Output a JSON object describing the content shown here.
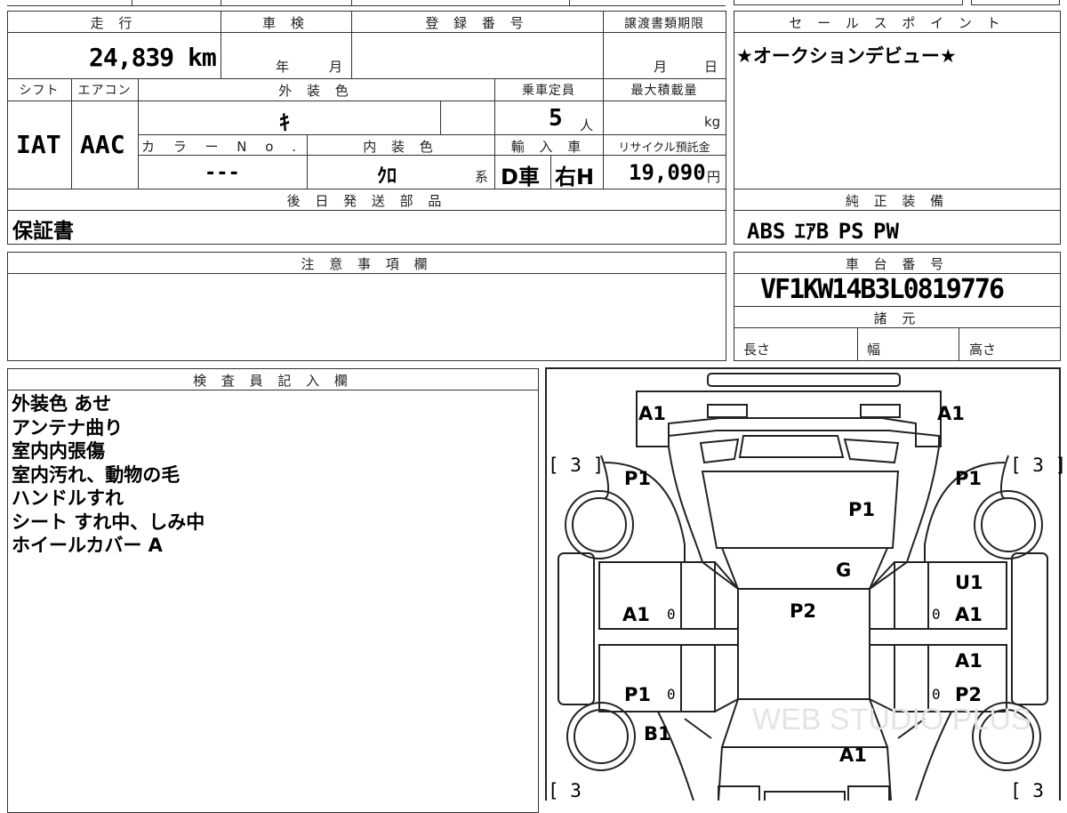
{
  "headers": {
    "mileage": "走 行",
    "inspection": "車 検",
    "registration": "登 録 番 号",
    "transfer_deadline": "譲渡書類期限",
    "sales_point": "セ ー ル ス ポ イ ン ト",
    "shift": "シフト",
    "aircon": "エアコン",
    "exterior_color": "外 装 色",
    "capacity": "乗車定員",
    "max_load": "最大積載量",
    "color_no": "カ ラ ー N o .",
    "interior_color": "内 装 色",
    "import": "輸 入 車",
    "recycle": "リサイクル預託金",
    "later_parts": "後 日 発 送 部 品",
    "equipment": "純 正 装 備",
    "notes": "注 意 事 項 欄",
    "chassis": "車 台 番 号",
    "specs": "諸 元",
    "inspector": "検 査 員 記 入 欄"
  },
  "vehicle": {
    "mileage": "24,839 km",
    "inspection_year_unit": "年",
    "inspection_month_unit": "月",
    "deadline_month_unit": "月",
    "deadline_day_unit": "日",
    "shift": "IAT",
    "aircon": "AAC",
    "exterior_color": "ｷ",
    "capacity": "5",
    "capacity_unit": "人",
    "max_load_unit": "kg",
    "color_no": "---",
    "interior_color": "ｸﾛ",
    "interior_suffix": "系",
    "import_type": "D車",
    "steering": "右H",
    "recycle_fee": "19,090",
    "recycle_unit": "円",
    "later_parts": "保証書",
    "equipment": "ABS ｴｱB PS PW",
    "chassis_number": "VF1KW14B3L0819776",
    "spec_length": "長さ",
    "spec_width": "幅",
    "spec_height": "高さ"
  },
  "sales_point_text": "★オークションデビュー★",
  "inspector_notes": [
    "外装色 あせ",
    "アンテナ曲り",
    "室内内張傷",
    "室内汚れ、動物の毛",
    "ハンドルすれ",
    "シート すれ中、しみ中",
    "ホイールカバー A"
  ],
  "diagram": {
    "front_left": "A1",
    "front_right": "A1",
    "tire_front_left": "[ 3 ]",
    "tire_front_right": "[ 3 ]",
    "tire_rear_left": "[ 3",
    "tire_rear_right": "[ 3",
    "fender_front_left": "P1",
    "fender_front_right": "P1",
    "hood": "P1",
    "windshield": "G",
    "roof": "P2",
    "door_front_left": "A1",
    "door_front_left_mark": "0",
    "door_front_right_1": "U1",
    "door_front_right_2": "A1",
    "door_front_right_mark": "0",
    "door_rear_left": "P1",
    "door_rear_left_mark": "0",
    "door_rear_right_1": "A1",
    "door_rear_right_2": "P2",
    "door_rear_right_mark": "0",
    "rear_left_fender": "B1",
    "rear": "A1",
    "watermark": "WEB STUDIO PLUS"
  }
}
